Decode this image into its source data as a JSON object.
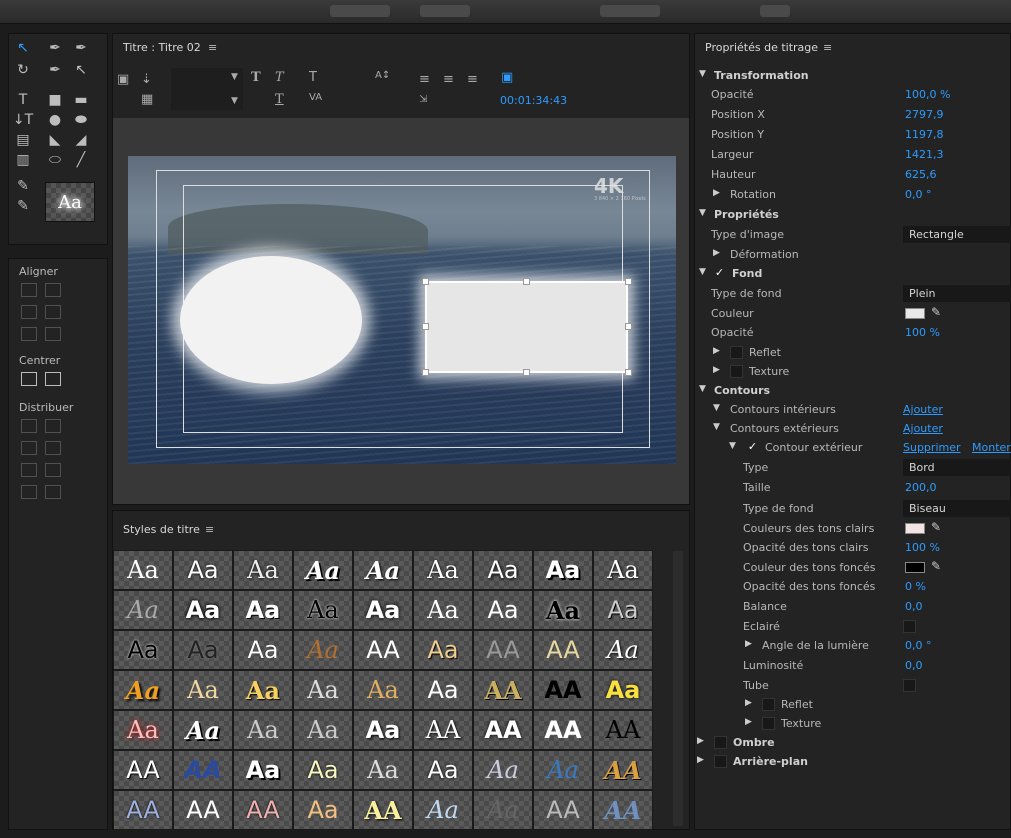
{
  "tools_panel": {
    "swatch_text": "Aa"
  },
  "align_panel": {
    "align_label": "Aligner",
    "center_label": "Centrer",
    "distribute_label": "Distribuer"
  },
  "title_panel": {
    "tab_label": "Titre : Titre 02",
    "timecode": "00:01:34:43",
    "watermark": "4K",
    "watermark_sub": "3 840 × 2 160 Pixels"
  },
  "styles_panel": {
    "tab_label": "Styles de titre",
    "swatch_text": "Aa",
    "swatch_text_upper": "AA"
  },
  "properties": {
    "tab_label": "Propriétés de titrage",
    "transformation": {
      "label": "Transformation",
      "opacity_label": "Opacité",
      "opacity": "100,0 %",
      "posx_label": "Position X",
      "posx": "2797,9",
      "posy_label": "Position Y",
      "posy": "1197,8",
      "width_label": "Largeur",
      "width": "1421,3",
      "height_label": "Hauteur",
      "height": "625,6",
      "rotation_label": "Rotation",
      "rotation": "0,0 °"
    },
    "proprietes": {
      "label": "Propriétés",
      "image_type_label": "Type d'image",
      "image_type": "Rectangle",
      "deformation_label": "Déformation"
    },
    "fond": {
      "label": "Fond",
      "fill_type_label": "Type de fond",
      "fill_type": "Plein",
      "color_label": "Couleur",
      "color": "#e8e8e8",
      "opacity_label": "Opacité",
      "opacity": "100 %",
      "reflet_label": "Reflet",
      "texture_label": "Texture"
    },
    "contours": {
      "label": "Contours",
      "inner_label": "Contours intérieurs",
      "inner_add": "Ajouter",
      "outer_label": "Contours extérieurs",
      "outer_add": "Ajouter",
      "outer_item_label": "Contour extérieur",
      "delete": "Supprimer",
      "move_up": "Monter",
      "type_label": "Type",
      "type": "Bord",
      "size_label": "Taille",
      "size": "200,0",
      "fill_type_label": "Type de fond",
      "fill_type": "Biseau",
      "light_color_label": "Couleurs des tons clairs",
      "light_color": "#f4e4e4",
      "light_opacity_label": "Opacité des tons clairs",
      "light_opacity": "100 %",
      "dark_color_label": "Couleur des tons foncés",
      "dark_color": "#000000",
      "dark_opacity_label": "Opacité des tons foncés",
      "dark_opacity": "0 %",
      "balance_label": "Balance",
      "balance": "0,0",
      "lit_label": "Eclairé",
      "light_angle_label": "Angle de la lumière",
      "light_angle": "0,0 °",
      "luminosity_label": "Luminosité",
      "luminosity": "0,0",
      "tube_label": "Tube",
      "reflet_label": "Reflet",
      "texture_label": "Texture"
    },
    "shadow_label": "Ombre",
    "background_label": "Arrière-plan"
  }
}
